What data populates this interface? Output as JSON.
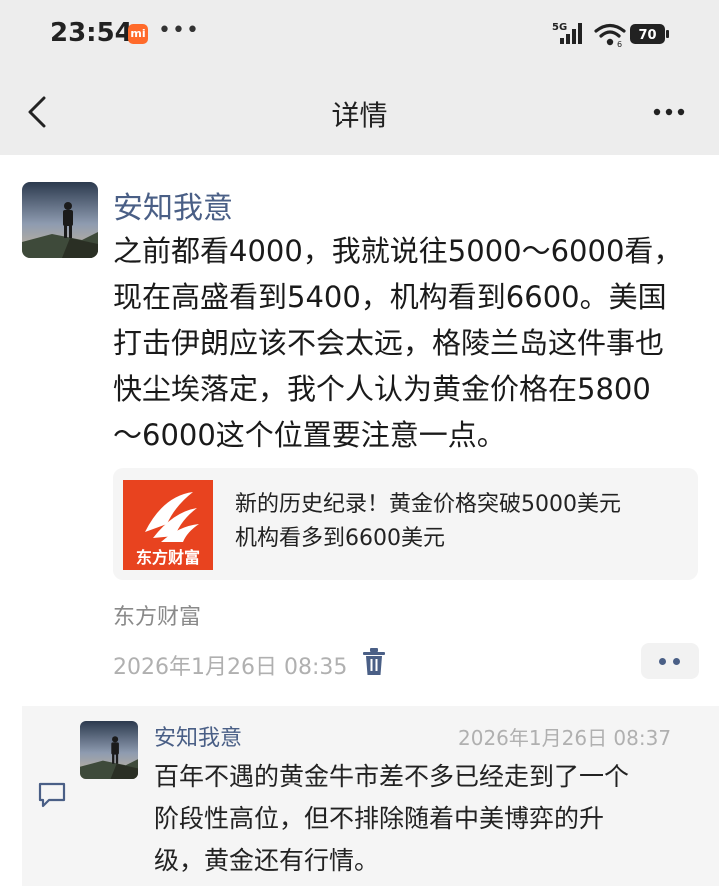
{
  "status_bar": {
    "time": "23:54",
    "badge": "mi",
    "dots": "•••",
    "network": "5G",
    "battery": "70"
  },
  "nav": {
    "title": "详情"
  },
  "post": {
    "author": "安知我意",
    "content_lines": [
      "之前都看4000，我就说往5000～6000看，",
      "现在高盛看到5400，机构看到6600。美国",
      "打击伊朗应该不会太远，格陵兰岛这件事也",
      "快尘埃落定，我个人认为黄金价格在5800",
      "～6000这个位置要注意一点。"
    ],
    "link": {
      "logo_text": "东方财富",
      "title_lines": [
        "新的历史纪录！黄金价格突破5000美元",
        "机构看多到6600美元"
      ]
    },
    "source": "东方财富",
    "time": "2026年1月26日 08:35"
  },
  "comment": {
    "author": "安知我意",
    "time": "2026年1月26日 08:37",
    "text_lines": [
      "百年不遇的黄金牛市差不多已经走到了一个",
      "阶段性高位，但不排除随着中美博弈的升",
      "级，黄金还有行情。"
    ]
  },
  "colors": {
    "accent": "#4a5f86",
    "brand_logo": "#e8431f",
    "top_bg": "#ededed"
  }
}
